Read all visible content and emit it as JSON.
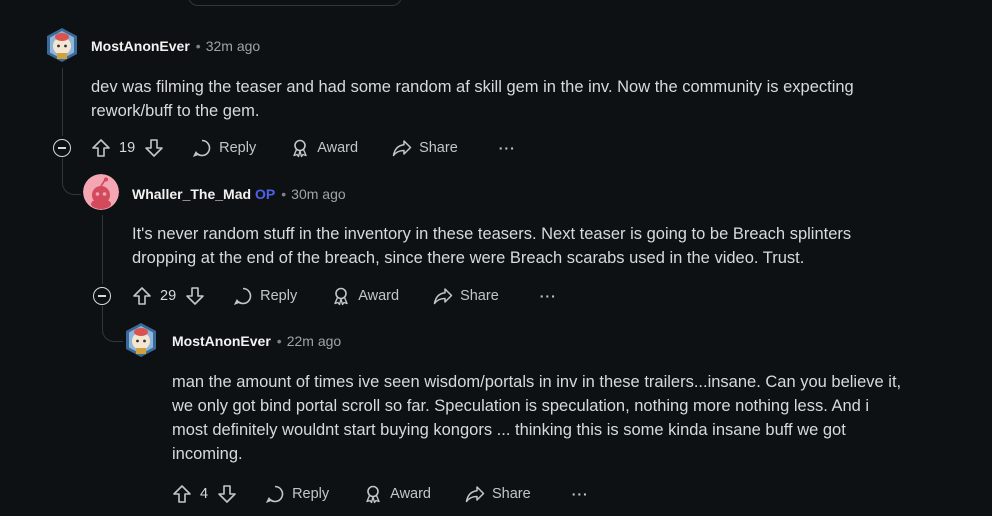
{
  "comments": [
    {
      "author": "MostAnonEver",
      "op": "",
      "time": "32m ago",
      "lines": [
        "dev was filming the teaser and had some random af skill gem in the inv. Now the community is expecting",
        "rework/buff to the gem."
      ],
      "votes": "19",
      "actions": {
        "reply": "Reply",
        "award": "Award",
        "share": "Share"
      }
    },
    {
      "author": "Whaller_The_Mad",
      "op": "OP",
      "time": "30m ago",
      "lines": [
        "It's never random stuff in the inventory in these teasers. Next teaser is going to be Breach splinters",
        "dropping at the end of the breach, since there were Breach scarabs used in the video. Trust."
      ],
      "votes": "29",
      "actions": {
        "reply": "Reply",
        "award": "Award",
        "share": "Share"
      }
    },
    {
      "author": "MostAnonEver",
      "op": "",
      "time": "22m ago",
      "lines": [
        "man the amount of times ive seen wisdom/portals in inv in these trailers...insane. Can you believe it,",
        "we only got bind portal scroll so far. Speculation is speculation, nothing more nothing less. And i",
        "most definitely wouldnt start buying kongors ... thinking this is some kinda insane buff we got",
        "incoming."
      ],
      "votes": "4",
      "actions": {
        "reply": "Reply",
        "award": "Award",
        "share": "Share"
      }
    }
  ],
  "separator": "•",
  "more_label": "···"
}
